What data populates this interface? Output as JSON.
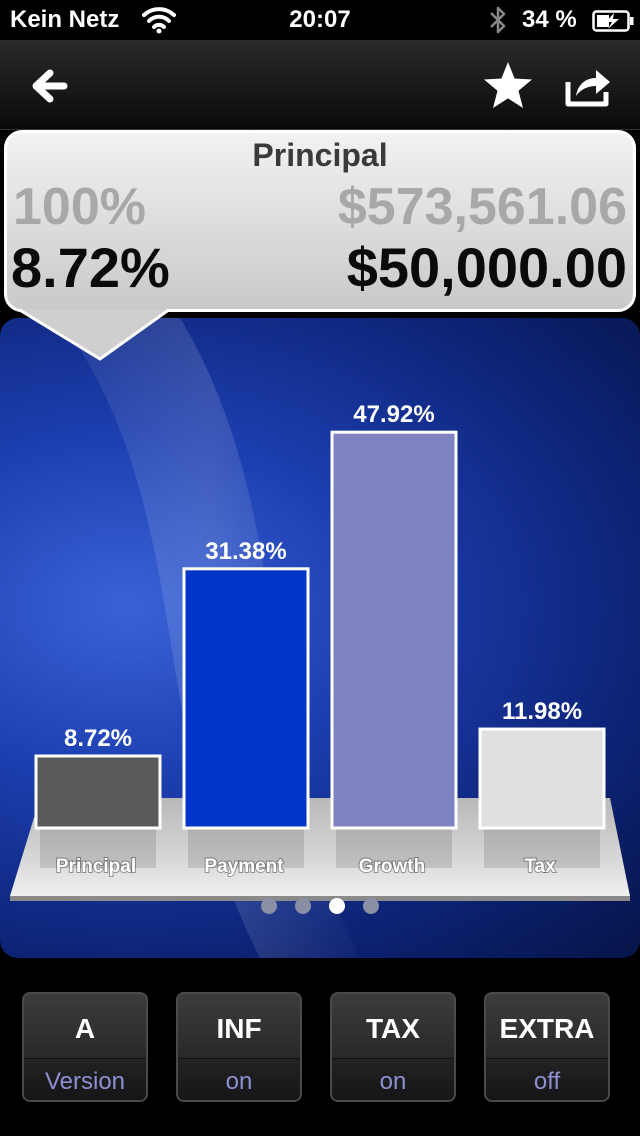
{
  "status_bar": {
    "carrier": "Kein Netz",
    "time": "20:07",
    "battery_percent": "34 %"
  },
  "nav": {
    "icons": [
      "back-arrow-icon",
      "star-icon",
      "share-icon"
    ]
  },
  "info": {
    "title": "Principal",
    "total_percent": "100%",
    "total_amount": "$573,561.06",
    "selected_percent": "8.72%",
    "selected_amount": "$50,000.00"
  },
  "chart_data": {
    "type": "bar",
    "categories": [
      "Principal",
      "Payment",
      "Growth",
      "Tax"
    ],
    "values": [
      8.72,
      31.38,
      47.92,
      11.98
    ],
    "value_labels": [
      "8.72%",
      "31.38%",
      "47.92%",
      "11.98%"
    ],
    "colors": [
      "#5a5a5a",
      "#0036c8",
      "#7f82c1",
      "#e0e0e0"
    ],
    "ylim": [
      0,
      50
    ],
    "grid": false
  },
  "pager": {
    "count": 4,
    "active": 2
  },
  "toolbar": {
    "buttons": [
      {
        "top": "A",
        "bottom": "Version"
      },
      {
        "top": "INF",
        "bottom": "on"
      },
      {
        "top": "TAX",
        "bottom": "on"
      },
      {
        "top": "EXTRA",
        "bottom": "off"
      }
    ]
  },
  "colors": {
    "accent_label": "#8d8fd2",
    "panel_blue": "#1c3eaf"
  }
}
